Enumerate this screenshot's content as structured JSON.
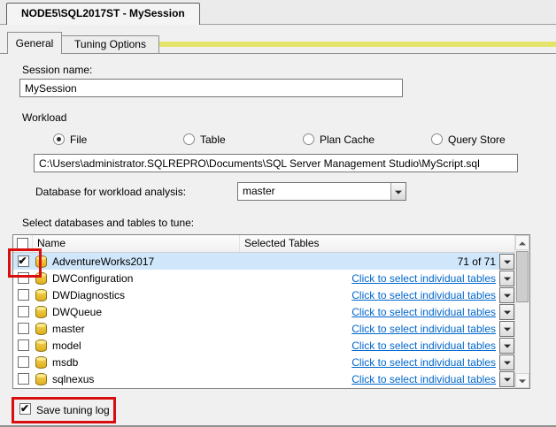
{
  "window": {
    "tab_title": "NODE5\\SQL2017ST - MySession"
  },
  "tabs": {
    "general": "General",
    "tuning_options": "Tuning Options"
  },
  "general_tab": {
    "session_name_label": "Session name:",
    "session_name_value": "MySession",
    "workload": {
      "group_label": "Workload",
      "source_options": [
        {
          "label": "File",
          "selected": true
        },
        {
          "label": "Table",
          "selected": false
        },
        {
          "label": "Plan Cache",
          "selected": false
        },
        {
          "label": "Query Store",
          "selected": false
        }
      ],
      "file_path": "C:\\Users\\administrator.SQLREPRO\\Documents\\SQL Server Management Studio\\MyScript.sql",
      "database_label": "Database for workload analysis:",
      "database_selected": "master"
    },
    "tune_grid": {
      "caption": "Select databases and tables to tune:",
      "header": {
        "name": "Name",
        "selected_tables": "Selected Tables"
      },
      "header_checkbox_checked": false,
      "rows": [
        {
          "name": "AdventureWorks2017",
          "checked": true,
          "selected": true,
          "tables_text": "71 of 71",
          "is_link": false
        },
        {
          "name": "DWConfiguration",
          "checked": false,
          "selected": false,
          "tables_text": "Click to select individual tables",
          "is_link": true
        },
        {
          "name": "DWDiagnostics",
          "checked": false,
          "selected": false,
          "tables_text": "Click to select individual tables",
          "is_link": true
        },
        {
          "name": "DWQueue",
          "checked": false,
          "selected": false,
          "tables_text": "Click to select individual tables",
          "is_link": true
        },
        {
          "name": "master",
          "checked": false,
          "selected": false,
          "tables_text": "Click to select individual tables",
          "is_link": true
        },
        {
          "name": "model",
          "checked": false,
          "selected": false,
          "tables_text": "Click to select individual tables",
          "is_link": true
        },
        {
          "name": "msdb",
          "checked": false,
          "selected": false,
          "tables_text": "Click to select individual tables",
          "is_link": true
        },
        {
          "name": "sqlnexus",
          "checked": false,
          "selected": false,
          "tables_text": "Click to select individual tables",
          "is_link": true
        }
      ]
    },
    "save_tuning_log_label": "Save tuning log",
    "save_tuning_log_checked": true
  },
  "colors": {
    "highlight_red": "#d90f0f",
    "selected_row_blue": "#cfe6fb",
    "link_blue": "#0066cc",
    "tab_accent_yellow": "#e4e46a",
    "db_icon_yellow": "#f0c83c",
    "background_gray": "#f0f0f0"
  }
}
